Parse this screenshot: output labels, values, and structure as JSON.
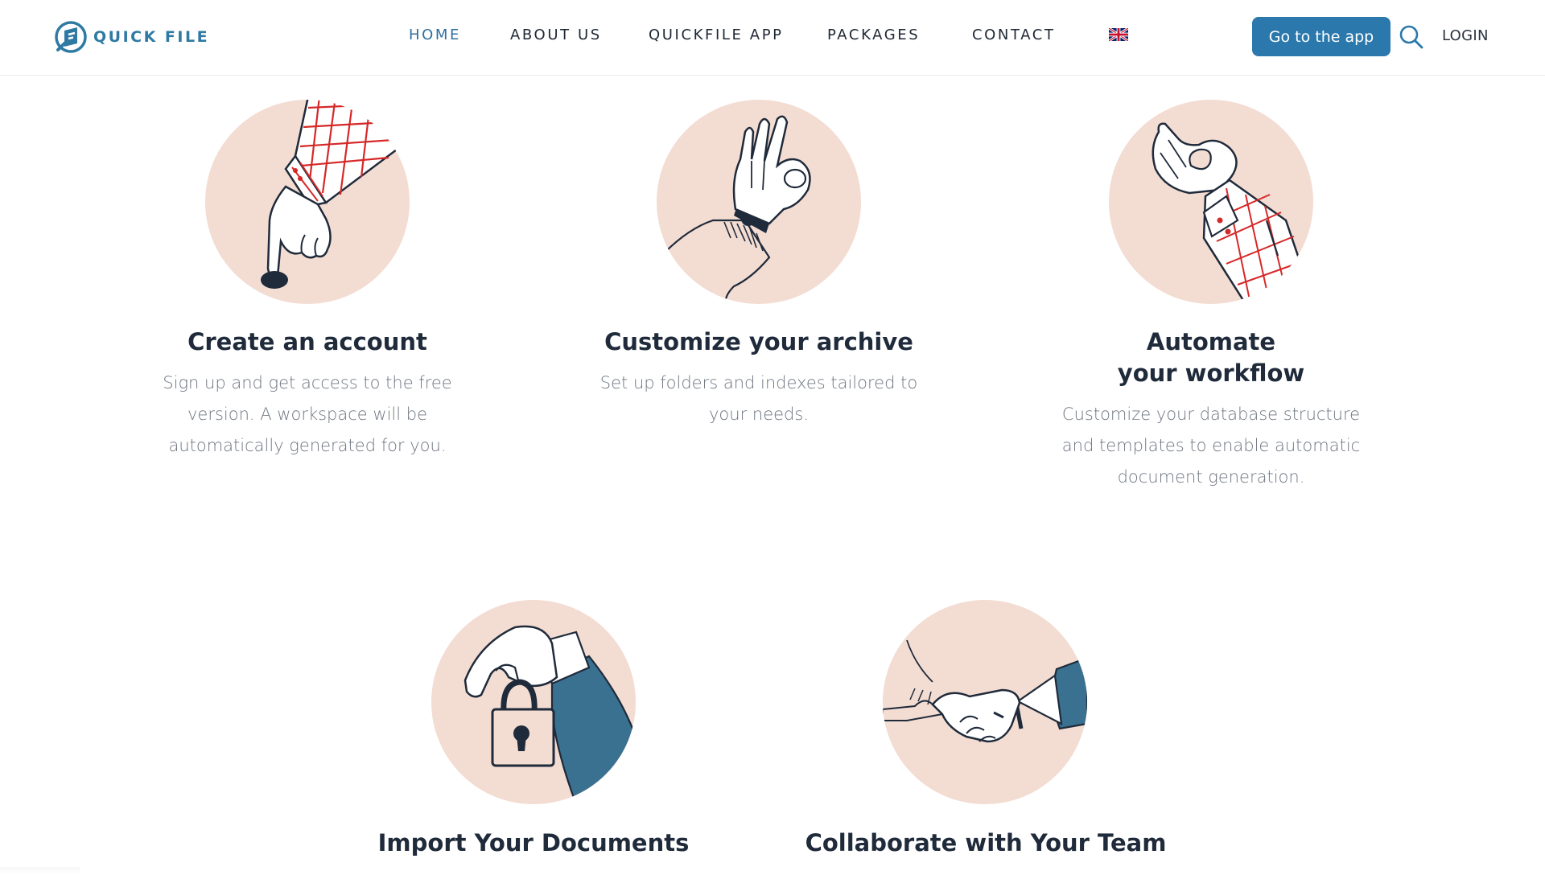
{
  "brand": {
    "name": "QUICK FILE",
    "color": "#2f7aa3"
  },
  "nav": {
    "items": [
      {
        "label": "HOME",
        "active": true
      },
      {
        "label": "ABOUT US",
        "active": false
      },
      {
        "label": "QUICKFILE APP",
        "active": false
      },
      {
        "label": "PACKAGES",
        "active": false
      },
      {
        "label": "CONTACT",
        "active": false
      }
    ],
    "language_flag": "uk-flag-icon",
    "cta_label": "Go to the app",
    "login_label": "LOGIN",
    "accent": "#2b78ad"
  },
  "features": [
    {
      "title": "Create an account",
      "description": "Sign up and get access to the free version. A workspace will be automatically generated for you.",
      "icon": "pointing-hand-icon"
    },
    {
      "title": "Customize your archive",
      "description": "Set up folders and indexes tailored to your needs.",
      "icon": "ok-hand-icon"
    },
    {
      "title": "Automate\nyour workflow",
      "description": "Customize your database structure and templates to enable automatic document generation.",
      "icon": "snap-hand-icon"
    },
    {
      "title": "Import Your Documents",
      "description": "",
      "icon": "padlock-hand-icon"
    },
    {
      "title": "Collaborate with Your Team",
      "description": "",
      "icon": "handshake-icon"
    }
  ],
  "colors": {
    "circle": "#f3dcd2",
    "plaid": "#d62828",
    "sleeve_blue": "#3a7090",
    "text_dark": "#1f2a3a",
    "text_muted": "#6f7680"
  }
}
